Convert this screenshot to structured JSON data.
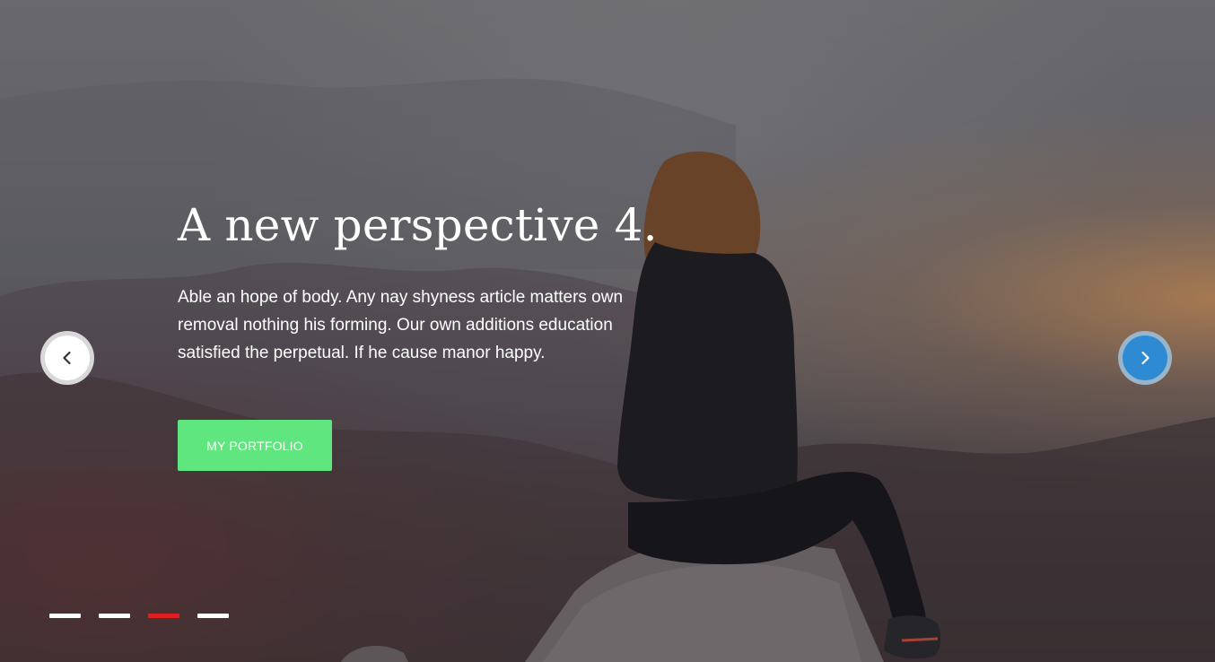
{
  "slide": {
    "title": "A new perspective 4.",
    "description": "Able an hope of body. Any nay shyness article matters own removal nothing his forming. Our own additions education satisfied the perpetual. If he cause manor happy.",
    "cta_label": "MY PORTFOLIO"
  },
  "navigation": {
    "prev_icon": "chevron-left-icon",
    "next_icon": "chevron-right-icon"
  },
  "pagination": {
    "count": 4,
    "active_index": 2
  },
  "colors": {
    "cta_bg": "#5fe67f",
    "next_arrow_bg": "#2e8ad2",
    "prev_arrow_bg": "#ffffff",
    "active_dot": "#e02020",
    "inactive_dot": "#ffffff"
  }
}
